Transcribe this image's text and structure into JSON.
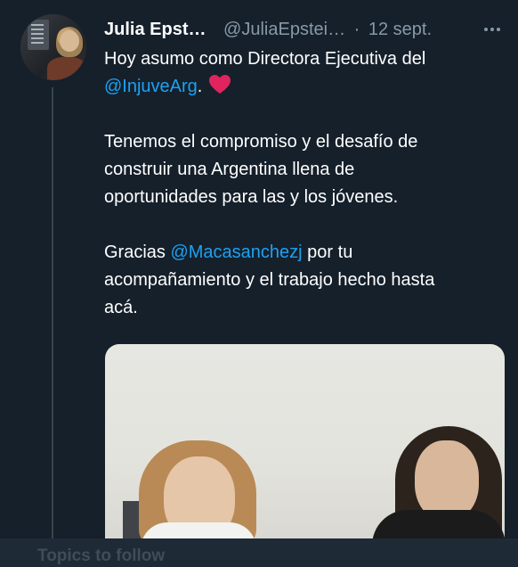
{
  "tweet": {
    "author_name": "Julia Epst…",
    "handle": "@JuliaEpstei…",
    "separator": "·",
    "date": "12 sept.",
    "body": {
      "line1_text": "Hoy asumo como Directora Ejecutiva del",
      "mention1": "@InjuveArg",
      "after_mention1": ".",
      "para2": [
        "Tenemos el compromiso y el desafío de",
        "construir una Argentina llena de",
        "oportunidades para las y los jóvenes."
      ],
      "para3_before": "Gracias ",
      "mention2": "@Macasanchezj",
      "para3_after": " por tu",
      "para3_rest": [
        "acompañamiento y el trabajo hecho hasta",
        "acá."
      ]
    },
    "icons": {
      "more": "more-horizontal-icon",
      "heart": "red-heart-emoji"
    },
    "colors": {
      "background": "#15202b",
      "link": "#1da1f2",
      "secondary_text": "#8899a6",
      "heart": "#e0245e"
    }
  },
  "footer": {
    "topics_label": "Topics to follow"
  }
}
